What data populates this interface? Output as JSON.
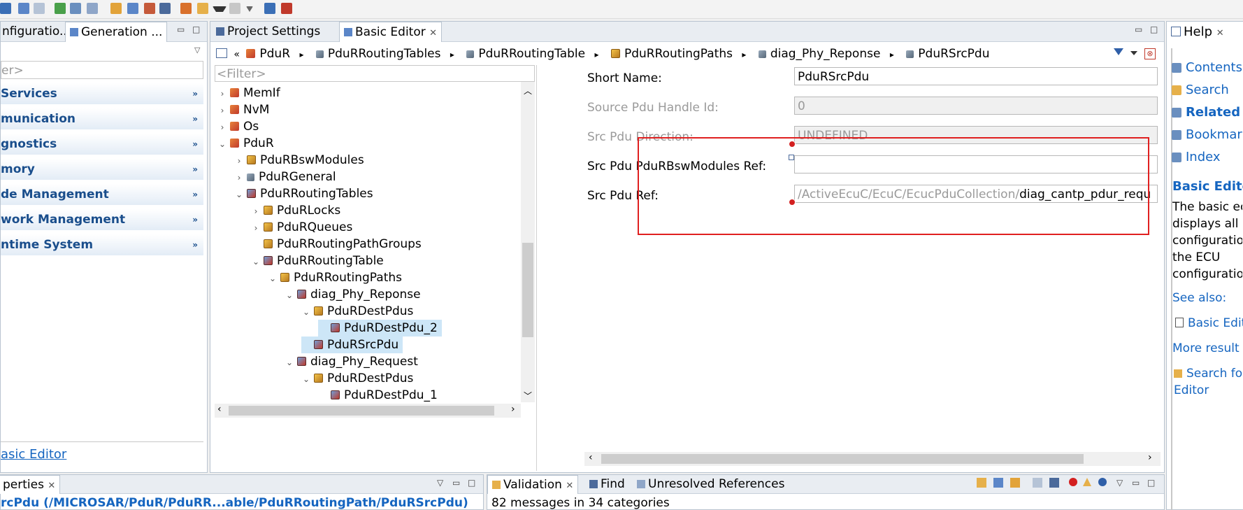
{
  "left_panel": {
    "tabs": [
      "nfiguratio...",
      "Generation ..."
    ],
    "filter_placeholder": "er>",
    "categories": [
      "Services",
      "munication",
      "gnostics",
      "mory",
      "de Management",
      "work Management",
      "ntime System"
    ],
    "bottom_link": "asic Editor"
  },
  "editor": {
    "tabs": [
      "Project Settings",
      "Basic Editor"
    ],
    "breadcrumb": [
      "PduR",
      "PduRRoutingTables",
      "PduRRoutingTable",
      "PduRRoutingPaths",
      "diag_Phy_Reponse",
      "PduRSrcPdu"
    ],
    "tree_filter_placeholder": "<Filter>",
    "tree": [
      {
        "label": "MemIf",
        "icon": "module"
      },
      {
        "label": "NvM",
        "icon": "module"
      },
      {
        "label": "Os",
        "icon": "module"
      },
      {
        "label": "PduR",
        "icon": "module"
      },
      {
        "label": "PduRBswModules",
        "icon": "cont"
      },
      {
        "label": "PduRGeneral",
        "icon": "gen"
      },
      {
        "label": "PduRRoutingTables",
        "icon": "ref"
      },
      {
        "label": "PduRLocks",
        "icon": "cont"
      },
      {
        "label": "PduRQueues",
        "icon": "cont"
      },
      {
        "label": "PduRRoutingPathGroups",
        "icon": "cont"
      },
      {
        "label": "PduRRoutingTable",
        "icon": "ref"
      },
      {
        "label": "PduRRoutingPaths",
        "icon": "cont"
      },
      {
        "label": "diag_Phy_Reponse",
        "icon": "ref"
      },
      {
        "label": "PduRDestPdus",
        "icon": "cont"
      },
      {
        "label": "PduRDestPdu_2",
        "icon": "ref"
      },
      {
        "label": "PduRSrcPdu",
        "icon": "ref"
      },
      {
        "label": "diag_Phy_Request",
        "icon": "ref"
      },
      {
        "label": "PduRDestPdus",
        "icon": "cont"
      },
      {
        "label": "PduRDestPdu_1",
        "icon": "ref"
      }
    ],
    "fields": [
      {
        "label": "Short Name:",
        "value": "PduRSrcPdu"
      },
      {
        "label": "Source Pdu Handle Id:",
        "value": "0"
      },
      {
        "label": "Src Pdu Direction:",
        "value": "UNDEFINED"
      },
      {
        "label": "Src Pdu PduRBswModules Ref:",
        "value": ""
      },
      {
        "label": "Src Pdu Ref:",
        "value_prefix": "/ActiveEcuC/EcuC/EcucPduCollection/",
        "value": "diag_cantp_pdur_requ"
      }
    ]
  },
  "help": {
    "title": "Help",
    "items": [
      "Contents",
      "Search",
      "Related T",
      "Bookmark",
      "Index"
    ],
    "section_title": "Basic Editor",
    "body": [
      "The basic ec",
      "displays all",
      "configuratio",
      "the ECU",
      "configuratio"
    ],
    "see_also": "See also:",
    "see_also_link": "Basic Edit",
    "more_results": "More result",
    "search_for": "Search fo",
    "search_for2": "Editor"
  },
  "bottom": {
    "left_tab": "perties",
    "left_path": "rcPdu (/MICROSAR/PduR/PduRR...able/PduRRoutingPath/PduRSrcPdu)",
    "tabs": [
      "Validation",
      "Find",
      "Unresolved References"
    ],
    "status": "82 messages in 34 categories"
  }
}
